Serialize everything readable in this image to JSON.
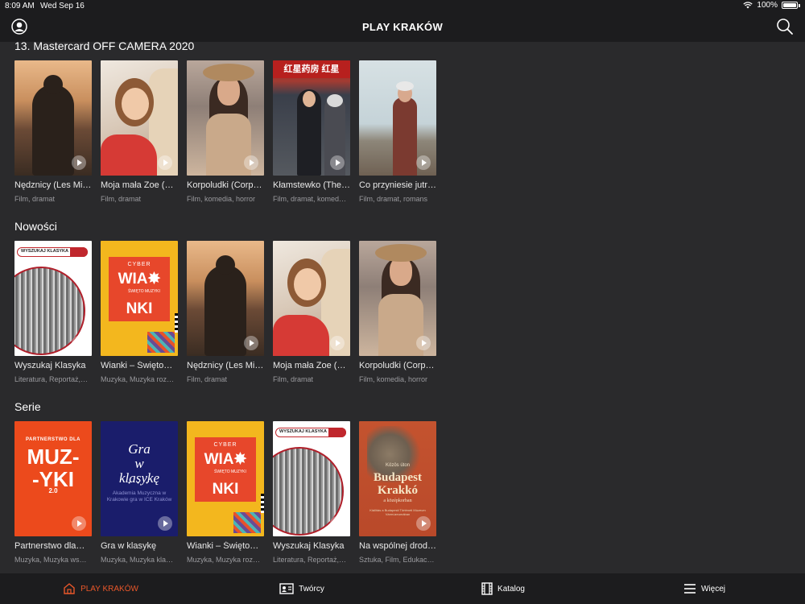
{
  "status_bar": {
    "time": "8:09 AM",
    "date": "Wed Sep 16",
    "battery": "100%"
  },
  "header": {
    "title": "PLAY KRAKÓW"
  },
  "sections": [
    {
      "title": "13. Mastercard OFF CAMERA 2020",
      "items": [
        {
          "title": "Nędznicy (Les Mi…",
          "genre": "Film, dramat"
        },
        {
          "title": "Moja mała Zoe (M…",
          "genre": "Film, dramat"
        },
        {
          "title": "Korpoludki (Corp…",
          "genre": "Film, komedia, horror"
        },
        {
          "title": "Kłamstewko (The…",
          "genre": "Film, dramat, komed…"
        },
        {
          "title": "Co przyniesie jutr…",
          "genre": "Film, dramat, romans"
        }
      ]
    },
    {
      "title": "Nowości",
      "items": [
        {
          "title": "Wyszukaj Klasyka",
          "genre": "Literatura, Reportaż,…"
        },
        {
          "title": "Wianki – Święto…",
          "genre": "Muzyka, Muzyka roz…"
        },
        {
          "title": "Nędznicy (Les Mi…",
          "genre": "Film, dramat"
        },
        {
          "title": "Moja mała Zoe (M…",
          "genre": "Film, dramat"
        },
        {
          "title": "Korpoludki (Corp…",
          "genre": "Film, komedia, horror"
        }
      ]
    },
    {
      "title": "Serie",
      "items": [
        {
          "title": "Partnerstwo dla…",
          "genre": "Muzyka, Muzyka ws…"
        },
        {
          "title": "Gra w klasykę",
          "genre": "Muzyka, Muzyka kla…"
        },
        {
          "title": "Wianki – Święto…",
          "genre": "Muzyka, Muzyka roz…"
        },
        {
          "title": "Wyszukaj Klasyka",
          "genre": "Literatura, Reportaż,…"
        },
        {
          "title": "Na wspólnej drod…",
          "genre": "Sztuka, Film, Edukac…"
        }
      ]
    }
  ],
  "posters": {
    "klasyka_bar": "WYSZUKAJ KLASYKA",
    "wianki_top": "CYBER",
    "wianki_line1": "WIA✸",
    "wianki_line2": "NKI",
    "wianki_small": "ŚWIĘTO MUZYKI",
    "muzyki_top": "PARTNERSTWO DLA",
    "muzyki_main": "MUZ-\n-YKI",
    "muzyki_ver": "2.0",
    "gra_title": "Gra\nw\nklasykę",
    "gra_dots": "• • •",
    "gra_sub": "Akademia Muzyczna w Krakowie gra w ICE Kraków",
    "budapest_top": "Közös úton",
    "budapest_title": "Budapest\nKrakkó",
    "budapest_sub": "a középkorban",
    "budapest_small": "Kiállítás a Budapesti Történeti Múzeum Vármúzeumában",
    "klamstewko_sign": "红星药房 红星"
  },
  "tabs": [
    {
      "label": "PLAY KRAKÓW",
      "icon": "home-icon",
      "active": true
    },
    {
      "label": "Twórcy",
      "icon": "creators-icon",
      "active": false
    },
    {
      "label": "Katalog",
      "icon": "film-strip-icon",
      "active": false
    },
    {
      "label": "Więcej",
      "icon": "menu-icon",
      "active": false
    }
  ],
  "colors": {
    "accent": "#e8572a",
    "background": "#2a2a2c",
    "bar": "#1c1c1e"
  }
}
